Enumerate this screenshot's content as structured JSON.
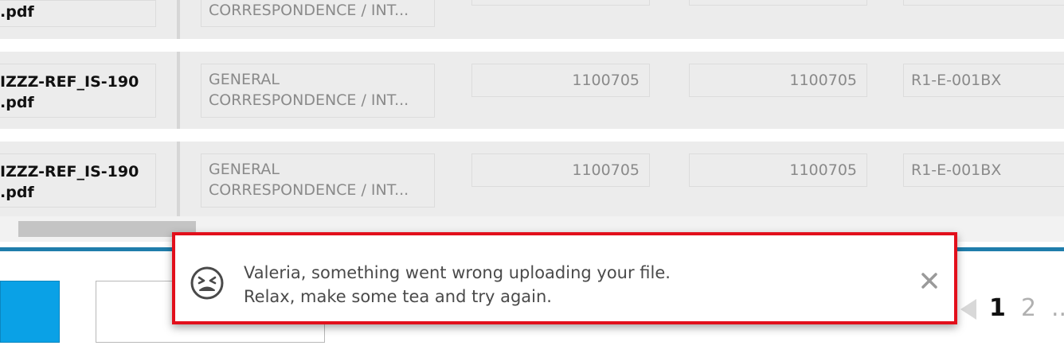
{
  "rows": [
    {
      "filename_line1": "",
      "filename_line2": ".pdf",
      "doc_line1": "",
      "doc_line2": "CORRESPONDENCE / INT...",
      "num1": "",
      "num2": "",
      "ref": ""
    },
    {
      "filename_line1": "IZZZ-REF_IS-190",
      "filename_line2": ".pdf",
      "doc_line1": "GENERAL",
      "doc_line2": "CORRESPONDENCE / INT...",
      "num1": "1100705",
      "num2": "1100705",
      "ref": "R1-E-001BX"
    },
    {
      "filename_line1": "IZZZ-REF_IS-190",
      "filename_line2": ".pdf",
      "doc_line1": "GENERAL",
      "doc_line2": "CORRESPONDENCE / INT...",
      "num1": "1100705",
      "num2": "1100705",
      "ref": "R1-E-001BX"
    }
  ],
  "toast": {
    "line1": "Valeria, something went wrong uploading your file.",
    "line2": "Relax, make some tea and try again.",
    "icon": "sad-face-icon",
    "close_icon": "close-icon",
    "border_color": "#e20f1b"
  },
  "pagination": {
    "prev_icon": "previous-page-icon",
    "page1": "1",
    "page2": "2",
    "more": ".."
  },
  "colors": {
    "accent_line": "#1f7dab",
    "primary_button": "#0aa1e6"
  }
}
